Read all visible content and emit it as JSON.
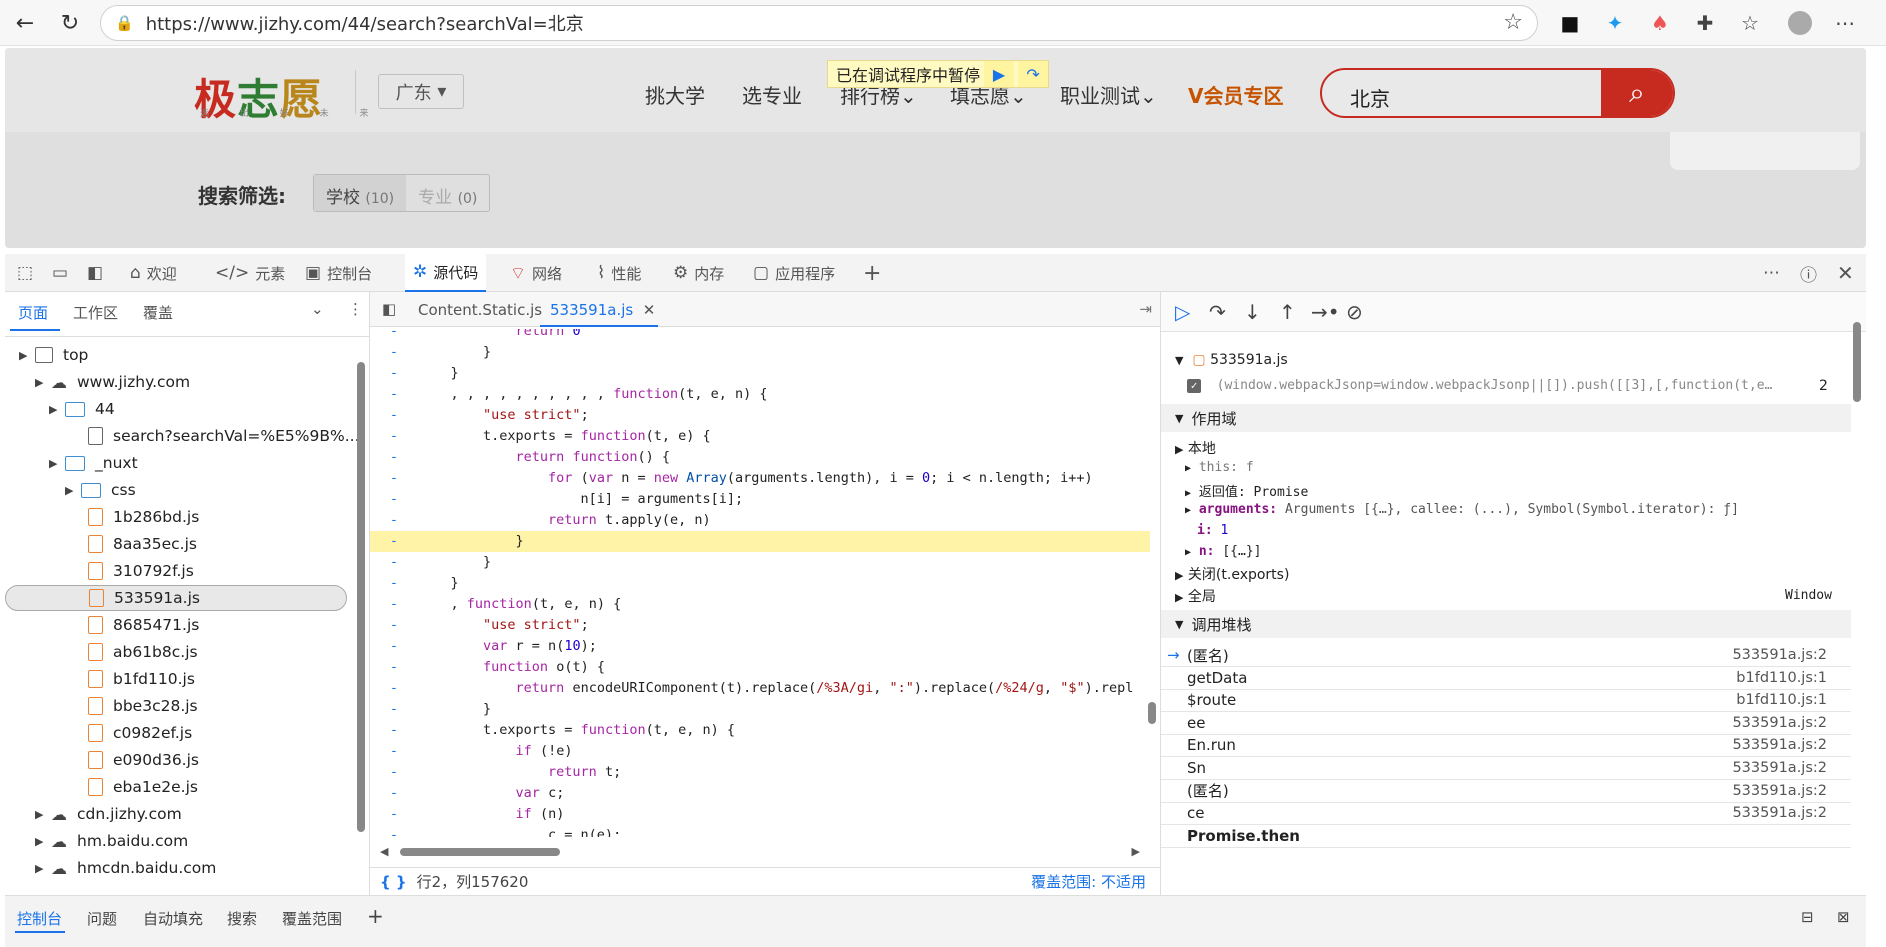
{
  "browser": {
    "url": "https://www.jizhy.com/44/search?searchVal=北京"
  },
  "site": {
    "logo": {
      "c1": "极",
      "c2": "志",
      "c3": "愿",
      "sub": "选 出 好 未 来"
    },
    "region": "广东",
    "nav": [
      "挑大学",
      "选专业",
      "排行榜",
      "填志愿",
      "职业测试"
    ],
    "vip": "会员专区",
    "search_value": "北京",
    "paused_banner": "已在调试程序中暂停",
    "filter_label": "搜索筛选:",
    "filter_tabs": [
      {
        "label": "学校",
        "count": "(10)"
      },
      {
        "label": "专业",
        "count": "(0)"
      }
    ]
  },
  "devtools": {
    "tabs": [
      "欢迎",
      "元素",
      "控制台",
      "源代码",
      "网络",
      "性能",
      "内存",
      "应用程序"
    ],
    "left_tabs": [
      "页面",
      "工作区",
      "覆盖"
    ],
    "tree": [
      {
        "label": "top",
        "level": 0
      },
      {
        "label": "www.jizhy.com",
        "level": 1
      },
      {
        "label": "44",
        "level": 2
      },
      {
        "label": "search?searchVal=%E5%9B%...",
        "level": 3
      },
      {
        "label": "_nuxt",
        "level": 2
      },
      {
        "label": "css",
        "level": 3
      },
      {
        "label": "1b286bd.js",
        "level": 3
      },
      {
        "label": "8aa35ec.js",
        "level": 3
      },
      {
        "label": "310792f.js",
        "level": 3
      },
      {
        "label": "533591a.js",
        "level": 3
      },
      {
        "label": "8685471.js",
        "level": 3
      },
      {
        "label": "ab61b8c.js",
        "level": 3
      },
      {
        "label": "b1fd110.js",
        "level": 3
      },
      {
        "label": "bbe3c28.js",
        "level": 3
      },
      {
        "label": "c0982ef.js",
        "level": 3
      },
      {
        "label": "e090d36.js",
        "level": 3
      },
      {
        "label": "eba1e2e.js",
        "level": 3
      },
      {
        "label": "cdn.jizhy.com",
        "level": 1
      },
      {
        "label": "hm.baidu.com",
        "level": 1
      },
      {
        "label": "hmcdn.baidu.com",
        "level": 1
      }
    ],
    "editor_tabs": [
      "Content.Static.js",
      "533591a.js"
    ],
    "status": {
      "pos": "行2，列157620",
      "coverage": "覆盖范围: 不适用"
    },
    "breakpoint_file": "533591a.js",
    "breakpoint_code": "(window.webpackJsonp=window.webpackJsonp||[]).push([[3],[,function(t,e…",
    "breakpoint_line": "2",
    "scope_header": "作用域",
    "scope_local": "本地",
    "scope_items": {
      "this": "this: f",
      "ret": "返回值: Promise",
      "args_k": "arguments:",
      "args_v": "Arguments [{…}, callee: (...), Symbol(Symbol.iterator): ƒ]",
      "i_k": "i:",
      "i_v": "1",
      "n_k": "n:",
      "n_v": "[{…}]"
    },
    "closure": "关闭(t.exports)",
    "global": "全局",
    "global_v": "Window",
    "callstack_header": "调用堆栈",
    "callstack": [
      {
        "name": "(匿名)",
        "loc": "533591a.js:2"
      },
      {
        "name": "getData",
        "loc": "b1fd110.js:1"
      },
      {
        "name": "$route",
        "loc": "b1fd110.js:1"
      },
      {
        "name": "ee",
        "loc": "533591a.js:2"
      },
      {
        "name": "En.run",
        "loc": "533591a.js:2"
      },
      {
        "name": "Sn",
        "loc": "533591a.js:2"
      },
      {
        "name": "(匿名)",
        "loc": "533591a.js:2"
      },
      {
        "name": "ce",
        "loc": "533591a.js:2"
      },
      {
        "name": "Promise.then",
        "loc": ""
      }
    ],
    "bottom_tabs": [
      "控制台",
      "问题",
      "自动填充",
      "搜索",
      "覆盖范围"
    ]
  },
  "colors": {
    "brand_red": "#c72b1f",
    "accent_blue": "#1a73e8",
    "highlight": "#fff3a8"
  }
}
